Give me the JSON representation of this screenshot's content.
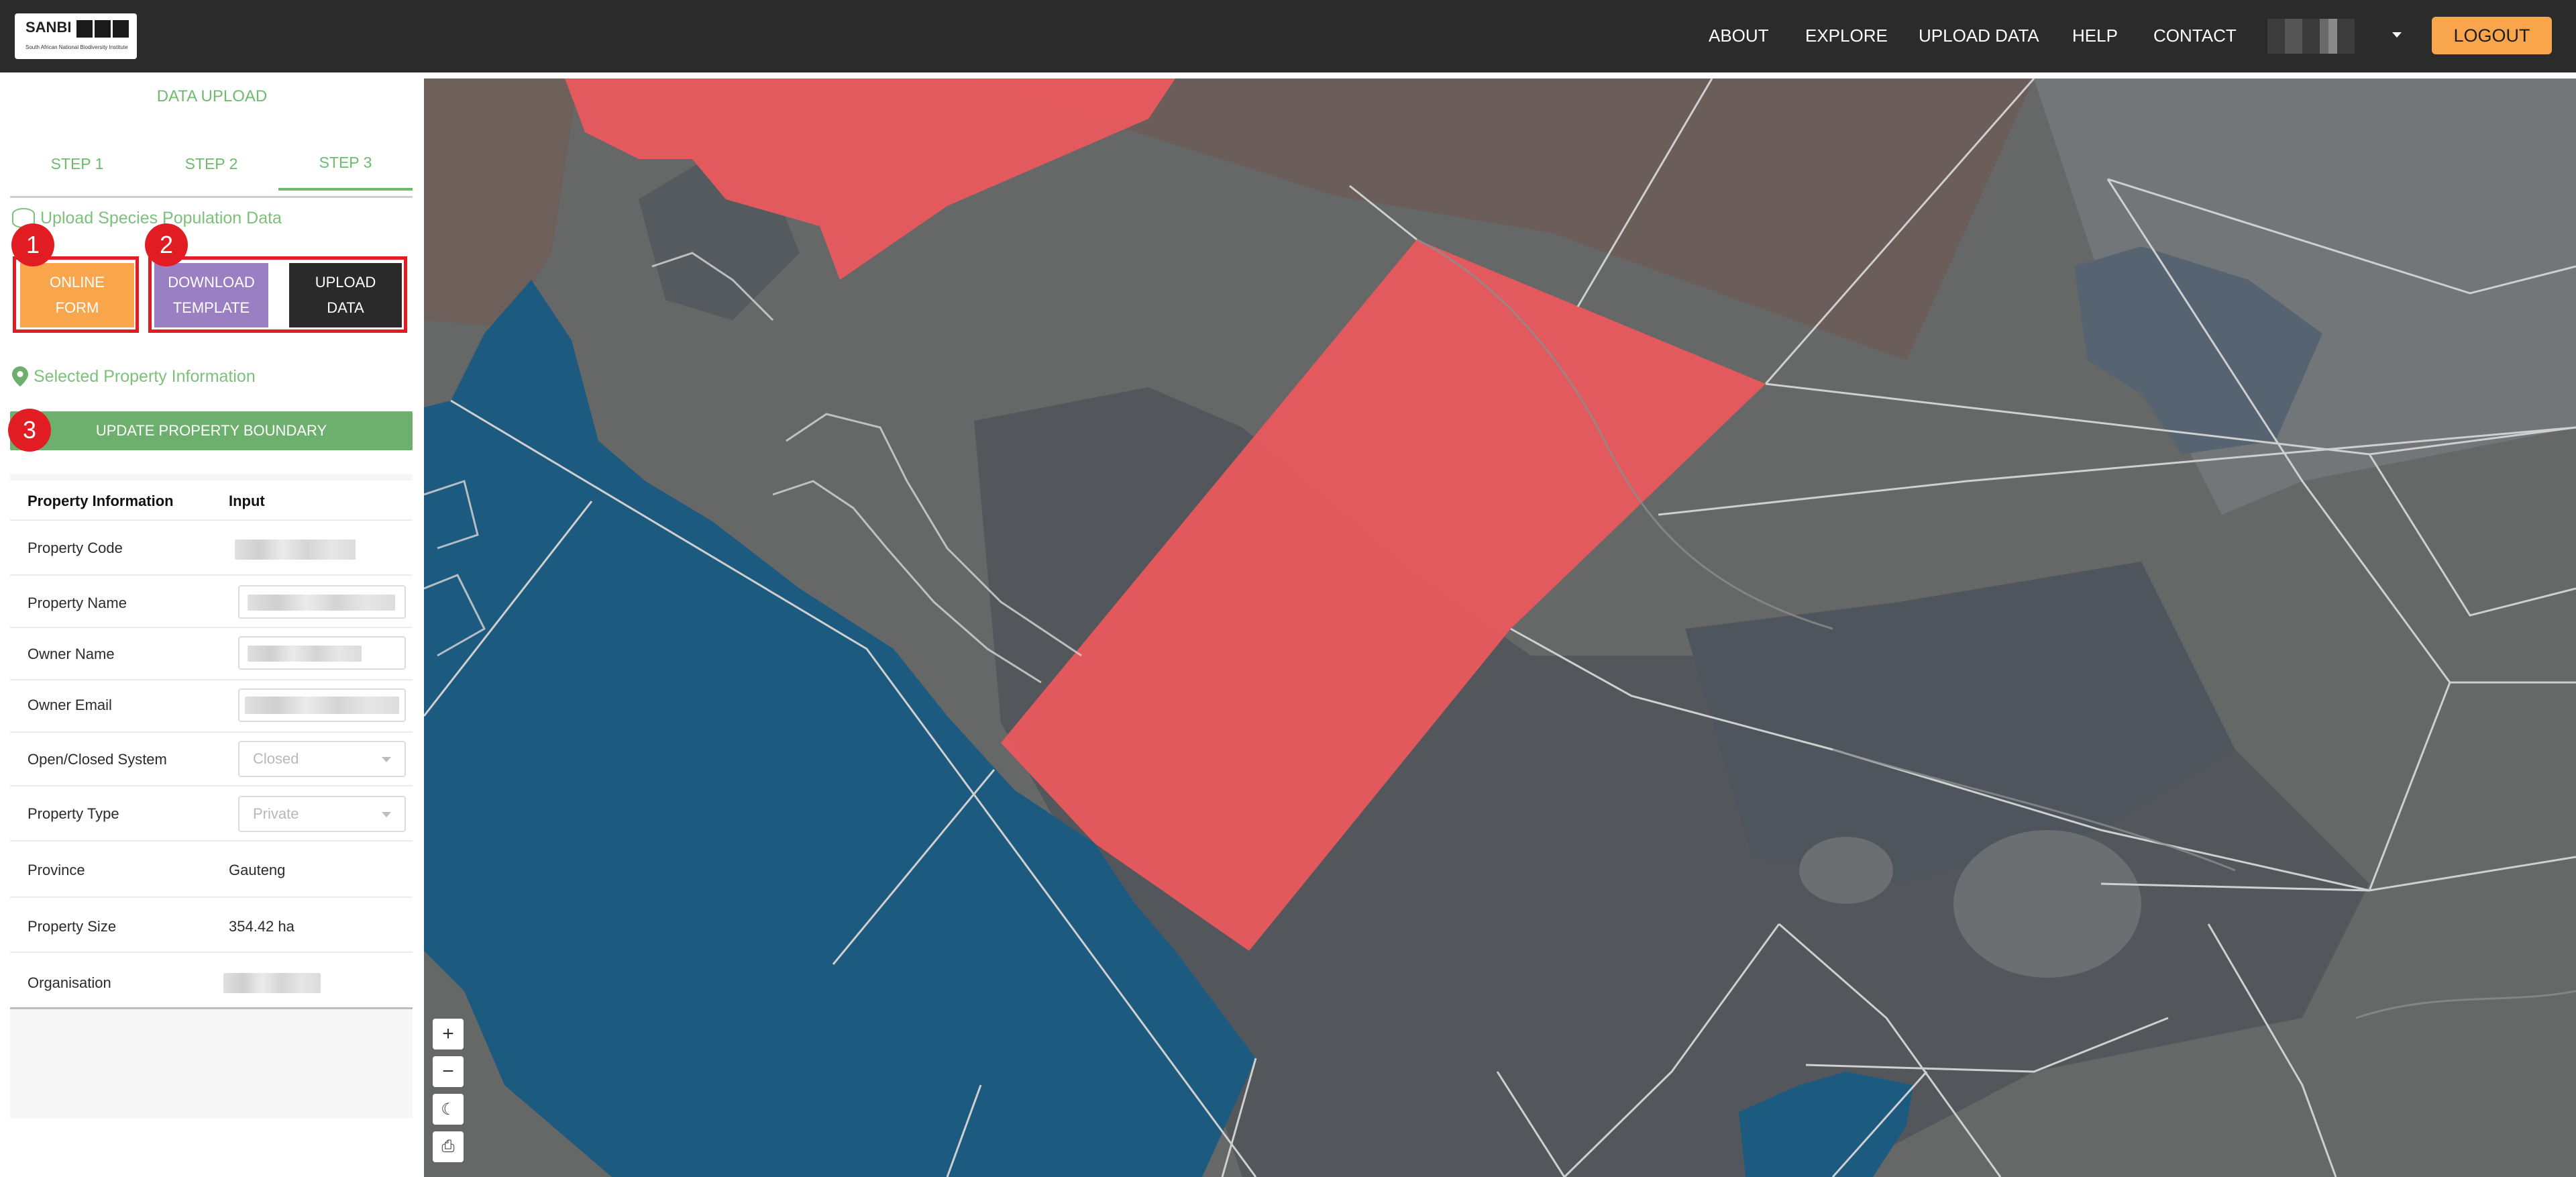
{
  "navbar": {
    "logo_text": "SANBI",
    "logo_sub": "South African National Biodiversity Institute",
    "links": [
      "ABOUT",
      "EXPLORE",
      "UPLOAD DATA",
      "HELP",
      "CONTACT"
    ],
    "logout_label": "LOGOUT"
  },
  "sidebar": {
    "title": "DATA UPLOAD",
    "tabs": [
      "STEP 1",
      "STEP 2",
      "STEP 3"
    ],
    "active_tab": "STEP 3",
    "upload_section_label": "Upload Species Population Data",
    "buttons": {
      "online_form": [
        "ONLINE",
        "FORM"
      ],
      "download_template": [
        "DOWNLOAD",
        "TEMPLATE"
      ],
      "upload_data": [
        "UPLOAD",
        "DATA"
      ]
    },
    "badges": [
      "1",
      "2",
      "3"
    ],
    "property_section_label": "Selected Property Information",
    "update_boundary_label": "UPDATE PROPERTY BOUNDARY",
    "table": {
      "header": [
        "Property Information",
        "Input"
      ],
      "rows": [
        {
          "label": "Property Code"
        },
        {
          "label": "Property Name"
        },
        {
          "label": "Owner Name"
        },
        {
          "label": "Owner Email"
        },
        {
          "label": "Open/Closed System",
          "value": "Closed"
        },
        {
          "label": "Property Type",
          "value": "Private"
        },
        {
          "label": "Province",
          "value": "Gauteng"
        },
        {
          "label": "Property Size",
          "value": "354.42 ha"
        },
        {
          "label": "Organisation"
        }
      ]
    }
  },
  "map": {
    "controls": [
      "+",
      "−",
      "☾",
      "⎙"
    ],
    "colors": {
      "selected": "#e85a5e",
      "water": "#1d5a7f",
      "land": "#666666",
      "dark_land": "#4f5358",
      "brown": "#6b5d59"
    }
  }
}
